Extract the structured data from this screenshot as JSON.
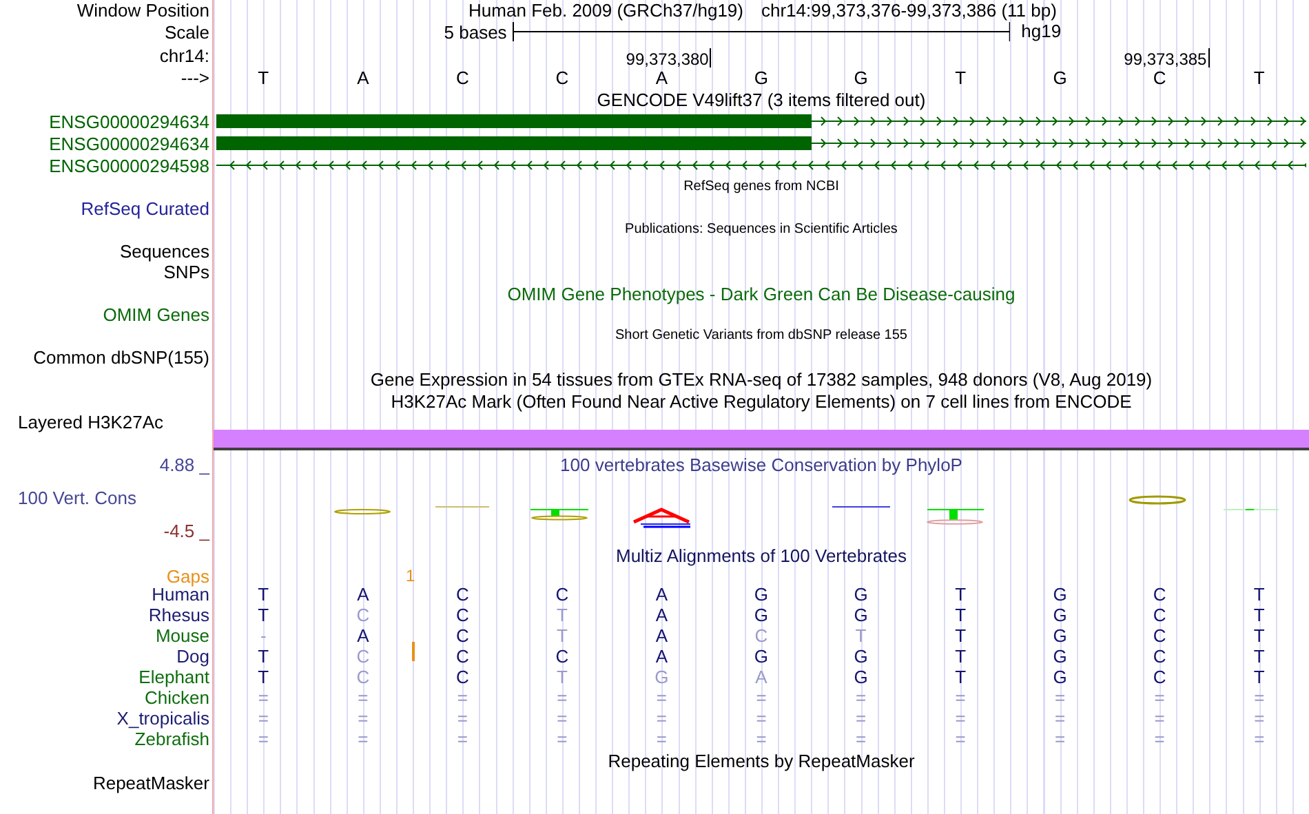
{
  "header": {
    "label": "Window Position",
    "title": "Human Feb. 2009 (GRCh37/hg19)",
    "position": "chr14:99,373,376-99,373,386 (11 bp)"
  },
  "scale": {
    "label": "Scale",
    "length": "5 bases",
    "assembly": "hg19"
  },
  "ruler": {
    "label": "chr14:",
    "ticks": [
      "99,373,380",
      "99,373,385"
    ]
  },
  "sequence": {
    "label": "--->",
    "bases": [
      "T",
      "A",
      "C",
      "C",
      "A",
      "G",
      "G",
      "T",
      "G",
      "C",
      "T"
    ]
  },
  "gencode": {
    "title": "GENCODE V49lift37 (3 items filtered out)",
    "items": [
      {
        "name": "ENSG00000294634",
        "kind": "coding",
        "forward": true
      },
      {
        "name": "ENSG00000294634",
        "kind": "coding",
        "forward": true
      },
      {
        "name": "ENSG00000294598",
        "kind": "noncoding",
        "forward": false
      }
    ]
  },
  "refseq": {
    "title": "RefSeq genes from NCBI",
    "label": "RefSeq Curated"
  },
  "publications": {
    "title": "Publications: Sequences in Scientific Articles",
    "labels": [
      "Sequences",
      "SNPs"
    ]
  },
  "omim": {
    "title": "OMIM Gene Phenotypes - Dark Green Can Be Disease-causing",
    "label": "OMIM Genes"
  },
  "dbsnp": {
    "title": "Short Genetic Variants from dbSNP release 155",
    "label": "Common dbSNP(155)"
  },
  "gtex": {
    "title": "Gene Expression in 54 tissues from GTEx RNA-seq of 17382 samples, 948 donors (V8, Aug 2019)"
  },
  "h3k27ac": {
    "title": "H3K27Ac Mark (Often Found Near Active Regulatory Elements) on 7 cell lines from ENCODE",
    "label": "Layered H3K27Ac"
  },
  "conservation": {
    "title": "100 vertebrates Basewise Conservation by PhyloP",
    "label": "100 Vert. Cons",
    "max": "4.88 _",
    "min": "-4.5 _"
  },
  "multiz": {
    "title": "Multiz Alignments of 100 Vertebrates",
    "gaps": {
      "label": "Gaps",
      "count": "1"
    },
    "species": [
      {
        "name": "Human",
        "color": "#1c1c70",
        "insertion": false,
        "bases": [
          {
            "base": "T",
            "match": true
          },
          {
            "base": "A",
            "match": true
          },
          {
            "base": "C",
            "match": true
          },
          {
            "base": "C",
            "match": true
          },
          {
            "base": "A",
            "match": true
          },
          {
            "base": "G",
            "match": true
          },
          {
            "base": "G",
            "match": true
          },
          {
            "base": "T",
            "match": true
          },
          {
            "base": "G",
            "match": true
          },
          {
            "base": "C",
            "match": true
          },
          {
            "base": "T",
            "match": true
          }
        ]
      },
      {
        "name": "Rhesus",
        "color": "#1c1c70",
        "insertion": false,
        "bases": [
          {
            "base": "T",
            "match": true
          },
          {
            "base": "C",
            "match": false
          },
          {
            "base": "C",
            "match": true
          },
          {
            "base": "T",
            "match": false
          },
          {
            "base": "A",
            "match": true
          },
          {
            "base": "G",
            "match": true
          },
          {
            "base": "G",
            "match": true
          },
          {
            "base": "T",
            "match": true
          },
          {
            "base": "G",
            "match": true
          },
          {
            "base": "C",
            "match": true
          },
          {
            "base": "T",
            "match": true
          }
        ]
      },
      {
        "name": "Mouse",
        "color": "#0e6e0e",
        "insertion": false,
        "bases": [
          {
            "base": "-",
            "match": false
          },
          {
            "base": "A",
            "match": true
          },
          {
            "base": "C",
            "match": true
          },
          {
            "base": "T",
            "match": false
          },
          {
            "base": "A",
            "match": true
          },
          {
            "base": "C",
            "match": false
          },
          {
            "base": "T",
            "match": false
          },
          {
            "base": "T",
            "match": true
          },
          {
            "base": "G",
            "match": true
          },
          {
            "base": "C",
            "match": true
          },
          {
            "base": "T",
            "match": true
          }
        ]
      },
      {
        "name": "Dog",
        "color": "#1c1c70",
        "insertion": true,
        "bases": [
          {
            "base": "T",
            "match": true
          },
          {
            "base": "C",
            "match": false
          },
          {
            "base": "C",
            "match": true
          },
          {
            "base": "C",
            "match": true
          },
          {
            "base": "A",
            "match": true
          },
          {
            "base": "G",
            "match": true
          },
          {
            "base": "G",
            "match": true
          },
          {
            "base": "T",
            "match": true
          },
          {
            "base": "G",
            "match": true
          },
          {
            "base": "C",
            "match": true
          },
          {
            "base": "T",
            "match": true
          }
        ]
      },
      {
        "name": "Elephant",
        "color": "#0e6e0e",
        "insertion": false,
        "bases": [
          {
            "base": "T",
            "match": true
          },
          {
            "base": "C",
            "match": false
          },
          {
            "base": "C",
            "match": true
          },
          {
            "base": "T",
            "match": false
          },
          {
            "base": "G",
            "match": false
          },
          {
            "base": "A",
            "match": false
          },
          {
            "base": "G",
            "match": true
          },
          {
            "base": "T",
            "match": true
          },
          {
            "base": "G",
            "match": true
          },
          {
            "base": "C",
            "match": true
          },
          {
            "base": "T",
            "match": true
          }
        ]
      },
      {
        "name": "Chicken",
        "color": "#0e6e0e",
        "insertion": false,
        "bases": [
          {
            "base": "=",
            "match": false
          },
          {
            "base": "=",
            "match": false
          },
          {
            "base": "=",
            "match": false
          },
          {
            "base": "=",
            "match": false
          },
          {
            "base": "=",
            "match": false
          },
          {
            "base": "=",
            "match": false
          },
          {
            "base": "=",
            "match": false
          },
          {
            "base": "=",
            "match": false
          },
          {
            "base": "=",
            "match": false
          },
          {
            "base": "=",
            "match": false
          },
          {
            "base": "=",
            "match": false
          }
        ]
      },
      {
        "name": "X_tropicalis",
        "color": "#1c1c70",
        "insertion": false,
        "bases": [
          {
            "base": "=",
            "match": false
          },
          {
            "base": "=",
            "match": false
          },
          {
            "base": "=",
            "match": false
          },
          {
            "base": "=",
            "match": false
          },
          {
            "base": "=",
            "match": false
          },
          {
            "base": "=",
            "match": false
          },
          {
            "base": "=",
            "match": false
          },
          {
            "base": "=",
            "match": false
          },
          {
            "base": "=",
            "match": false
          },
          {
            "base": "=",
            "match": false
          },
          {
            "base": "=",
            "match": false
          }
        ]
      },
      {
        "name": "Zebrafish",
        "color": "#0e6e0e",
        "insertion": false,
        "bases": [
          {
            "base": "=",
            "match": false
          },
          {
            "base": "=",
            "match": false
          },
          {
            "base": "=",
            "match": false
          },
          {
            "base": "=",
            "match": false
          },
          {
            "base": "=",
            "match": false
          },
          {
            "base": "=",
            "match": false
          },
          {
            "base": "=",
            "match": false
          },
          {
            "base": "=",
            "match": false
          },
          {
            "base": "=",
            "match": false
          },
          {
            "base": "=",
            "match": false
          },
          {
            "base": "=",
            "match": false
          }
        ]
      }
    ]
  },
  "repeatmasker": {
    "title": "Repeating Elements by RepeatMasker",
    "label": "RepeatMasker"
  }
}
